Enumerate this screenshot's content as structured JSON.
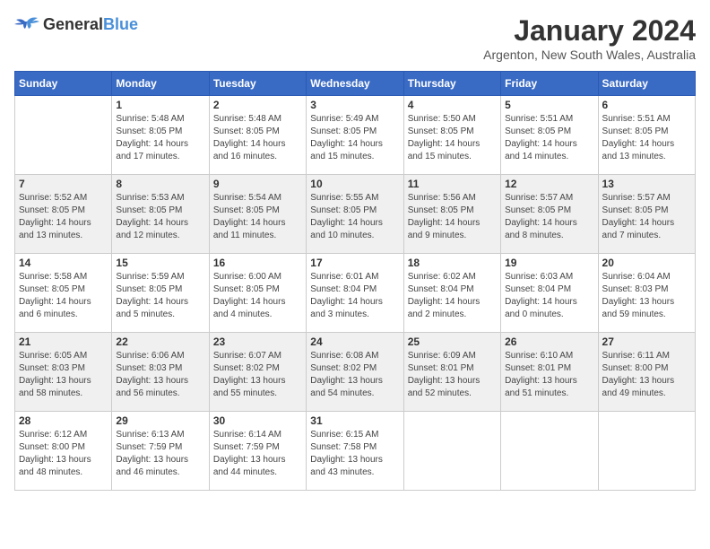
{
  "logo": {
    "general": "General",
    "blue": "Blue"
  },
  "title": {
    "month_year": "January 2024",
    "location": "Argenton, New South Wales, Australia"
  },
  "days_of_week": [
    "Sunday",
    "Monday",
    "Tuesday",
    "Wednesday",
    "Thursday",
    "Friday",
    "Saturday"
  ],
  "weeks": [
    [
      {
        "day": "",
        "info": ""
      },
      {
        "day": "1",
        "info": "Sunrise: 5:48 AM\nSunset: 8:05 PM\nDaylight: 14 hours\nand 17 minutes."
      },
      {
        "day": "2",
        "info": "Sunrise: 5:48 AM\nSunset: 8:05 PM\nDaylight: 14 hours\nand 16 minutes."
      },
      {
        "day": "3",
        "info": "Sunrise: 5:49 AM\nSunset: 8:05 PM\nDaylight: 14 hours\nand 15 minutes."
      },
      {
        "day": "4",
        "info": "Sunrise: 5:50 AM\nSunset: 8:05 PM\nDaylight: 14 hours\nand 15 minutes."
      },
      {
        "day": "5",
        "info": "Sunrise: 5:51 AM\nSunset: 8:05 PM\nDaylight: 14 hours\nand 14 minutes."
      },
      {
        "day": "6",
        "info": "Sunrise: 5:51 AM\nSunset: 8:05 PM\nDaylight: 14 hours\nand 13 minutes."
      }
    ],
    [
      {
        "day": "7",
        "info": "Sunrise: 5:52 AM\nSunset: 8:05 PM\nDaylight: 14 hours\nand 13 minutes."
      },
      {
        "day": "8",
        "info": "Sunrise: 5:53 AM\nSunset: 8:05 PM\nDaylight: 14 hours\nand 12 minutes."
      },
      {
        "day": "9",
        "info": "Sunrise: 5:54 AM\nSunset: 8:05 PM\nDaylight: 14 hours\nand 11 minutes."
      },
      {
        "day": "10",
        "info": "Sunrise: 5:55 AM\nSunset: 8:05 PM\nDaylight: 14 hours\nand 10 minutes."
      },
      {
        "day": "11",
        "info": "Sunrise: 5:56 AM\nSunset: 8:05 PM\nDaylight: 14 hours\nand 9 minutes."
      },
      {
        "day": "12",
        "info": "Sunrise: 5:57 AM\nSunset: 8:05 PM\nDaylight: 14 hours\nand 8 minutes."
      },
      {
        "day": "13",
        "info": "Sunrise: 5:57 AM\nSunset: 8:05 PM\nDaylight: 14 hours\nand 7 minutes."
      }
    ],
    [
      {
        "day": "14",
        "info": "Sunrise: 5:58 AM\nSunset: 8:05 PM\nDaylight: 14 hours\nand 6 minutes."
      },
      {
        "day": "15",
        "info": "Sunrise: 5:59 AM\nSunset: 8:05 PM\nDaylight: 14 hours\nand 5 minutes."
      },
      {
        "day": "16",
        "info": "Sunrise: 6:00 AM\nSunset: 8:05 PM\nDaylight: 14 hours\nand 4 minutes."
      },
      {
        "day": "17",
        "info": "Sunrise: 6:01 AM\nSunset: 8:04 PM\nDaylight: 14 hours\nand 3 minutes."
      },
      {
        "day": "18",
        "info": "Sunrise: 6:02 AM\nSunset: 8:04 PM\nDaylight: 14 hours\nand 2 minutes."
      },
      {
        "day": "19",
        "info": "Sunrise: 6:03 AM\nSunset: 8:04 PM\nDaylight: 14 hours\nand 0 minutes."
      },
      {
        "day": "20",
        "info": "Sunrise: 6:04 AM\nSunset: 8:03 PM\nDaylight: 13 hours\nand 59 minutes."
      }
    ],
    [
      {
        "day": "21",
        "info": "Sunrise: 6:05 AM\nSunset: 8:03 PM\nDaylight: 13 hours\nand 58 minutes."
      },
      {
        "day": "22",
        "info": "Sunrise: 6:06 AM\nSunset: 8:03 PM\nDaylight: 13 hours\nand 56 minutes."
      },
      {
        "day": "23",
        "info": "Sunrise: 6:07 AM\nSunset: 8:02 PM\nDaylight: 13 hours\nand 55 minutes."
      },
      {
        "day": "24",
        "info": "Sunrise: 6:08 AM\nSunset: 8:02 PM\nDaylight: 13 hours\nand 54 minutes."
      },
      {
        "day": "25",
        "info": "Sunrise: 6:09 AM\nSunset: 8:01 PM\nDaylight: 13 hours\nand 52 minutes."
      },
      {
        "day": "26",
        "info": "Sunrise: 6:10 AM\nSunset: 8:01 PM\nDaylight: 13 hours\nand 51 minutes."
      },
      {
        "day": "27",
        "info": "Sunrise: 6:11 AM\nSunset: 8:00 PM\nDaylight: 13 hours\nand 49 minutes."
      }
    ],
    [
      {
        "day": "28",
        "info": "Sunrise: 6:12 AM\nSunset: 8:00 PM\nDaylight: 13 hours\nand 48 minutes."
      },
      {
        "day": "29",
        "info": "Sunrise: 6:13 AM\nSunset: 7:59 PM\nDaylight: 13 hours\nand 46 minutes."
      },
      {
        "day": "30",
        "info": "Sunrise: 6:14 AM\nSunset: 7:59 PM\nDaylight: 13 hours\nand 44 minutes."
      },
      {
        "day": "31",
        "info": "Sunrise: 6:15 AM\nSunset: 7:58 PM\nDaylight: 13 hours\nand 43 minutes."
      },
      {
        "day": "",
        "info": ""
      },
      {
        "day": "",
        "info": ""
      },
      {
        "day": "",
        "info": ""
      }
    ]
  ]
}
